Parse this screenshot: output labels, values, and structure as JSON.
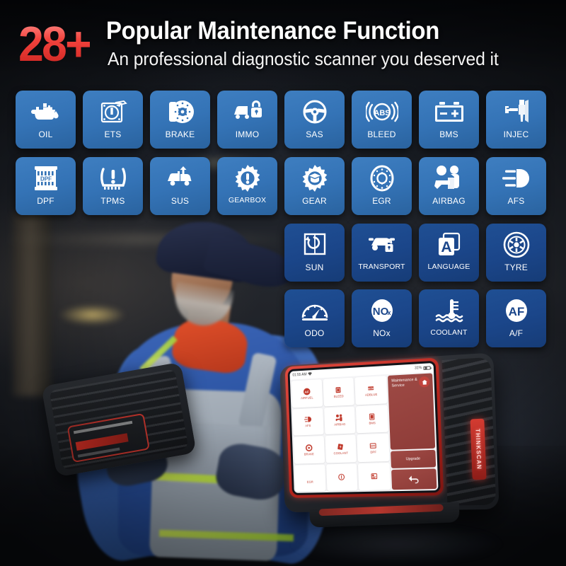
{
  "header": {
    "number": "28+",
    "title": "Popular Maintenance Function",
    "subtitle": "An professional diagnostic scanner you deserved it",
    "accent_color": "#e8372f",
    "title_color": "#ffffff"
  },
  "grid": {
    "tile_color_light": "#3473b6",
    "tile_color_dark": "#1b468a",
    "rows": [
      {
        "style": "light",
        "items": [
          {
            "label": "OIL",
            "icon": "oil-can-icon"
          },
          {
            "label": "ETS",
            "icon": "ets-throttle-icon"
          },
          {
            "label": "BRAKE",
            "icon": "brake-disc-icon"
          },
          {
            "label": "IMMO",
            "icon": "car-lock-icon"
          },
          {
            "label": "SAS",
            "icon": "steering-wheel-icon"
          },
          {
            "label": "BLEED",
            "icon": "abs-bleed-icon"
          },
          {
            "label": "BMS",
            "icon": "battery-icon"
          },
          {
            "label": "INJEC",
            "icon": "injector-caliper-icon"
          }
        ]
      },
      {
        "style": "light",
        "items": [
          {
            "label": "DPF",
            "icon": "dpf-filter-icon"
          },
          {
            "label": "TPMS",
            "icon": "tyre-pressure-icon"
          },
          {
            "label": "SUS",
            "icon": "suspension-car-icon"
          },
          {
            "label": "GEARBOX",
            "icon": "gear-exclaim-icon"
          },
          {
            "label": "GEAR",
            "icon": "gear-oil-icon"
          },
          {
            "label": "EGR",
            "icon": "egr-valve-icon"
          },
          {
            "label": "AIRBAG",
            "icon": "airbag-seat-icon"
          },
          {
            "label": "AFS",
            "icon": "headlight-icon"
          }
        ]
      },
      {
        "style": "dark",
        "items": [
          {
            "label": "SUN",
            "icon": "sunroof-reset-icon"
          },
          {
            "label": "TRANSPORT",
            "icon": "transport-mode-icon"
          },
          {
            "label": "LANGUAGE",
            "icon": "language-a-icon"
          },
          {
            "label": "TYRE",
            "icon": "tyre-wheel-icon"
          }
        ]
      },
      {
        "style": "dark",
        "items": [
          {
            "label": "ODO",
            "icon": "odometer-icon"
          },
          {
            "label": "NOx",
            "icon": "nox-sensor-icon"
          },
          {
            "label": "COOLANT",
            "icon": "coolant-temp-icon"
          },
          {
            "label": "A/F",
            "icon": "air-fuel-icon"
          }
        ]
      }
    ]
  },
  "device": {
    "brand": "THINKSCAN",
    "status_bar": {
      "time": "01:55 AM",
      "battery": "31%",
      "wifi_icon": "wifi-icon"
    },
    "screen_apps": [
      {
        "label": "AIRFUEL",
        "icon": "af-circle-icon"
      },
      {
        "label": "BLEED",
        "icon": "bleed-icon"
      },
      {
        "label": "ADBLUE",
        "icon": "bcm-icon"
      },
      {
        "label": "AFS",
        "icon": "headlight-icon"
      },
      {
        "label": "AIRBAG",
        "icon": "airbag-icon"
      },
      {
        "label": "BMS",
        "icon": "battery-small-icon"
      },
      {
        "label": "BRAKE",
        "icon": "brake-small-icon"
      },
      {
        "label": "COOLANT",
        "icon": "coolant-small-icon"
      },
      {
        "label": "DPF",
        "icon": "dpf-small-icon"
      },
      {
        "label": "EGR",
        "icon": "egr-small-icon"
      },
      {
        "label": "",
        "icon": "ets-small-icon"
      },
      {
        "label": "",
        "icon": "gearbox-small-icon"
      }
    ],
    "side_panel": {
      "title": "Maintenance & Service",
      "home_icon": "home-icon",
      "upgrade_label": "Upgrade",
      "back_icon": "back-arrow-icon"
    }
  }
}
